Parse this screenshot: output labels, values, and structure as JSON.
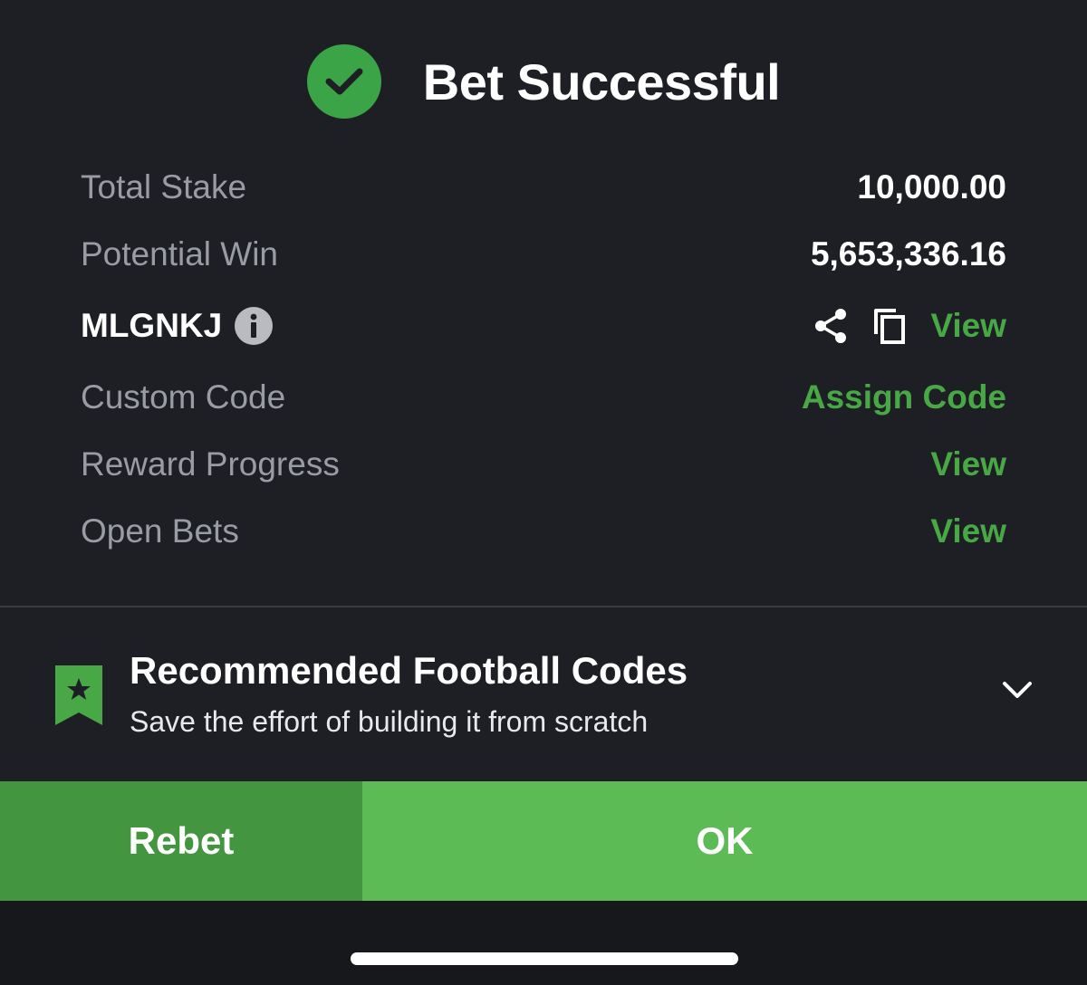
{
  "header": {
    "title": "Bet Successful",
    "icon": "check-circle-icon"
  },
  "summary": {
    "total_stake_label": "Total Stake",
    "total_stake_value": "10,000.00",
    "potential_win_label": "Potential Win",
    "potential_win_value": "5,653,336.16",
    "booking_code": "MLGNKJ",
    "booking_view_label": "View",
    "custom_code_label": "Custom Code",
    "custom_code_action": "Assign Code",
    "reward_progress_label": "Reward Progress",
    "reward_progress_action": "View",
    "open_bets_label": "Open Bets",
    "open_bets_action": "View"
  },
  "recommended": {
    "title": "Recommended Football Codes",
    "subtitle": "Save the effort of building it from scratch"
  },
  "buttons": {
    "rebet": "Rebet",
    "ok": "OK"
  },
  "colors": {
    "background": "#1e1f24",
    "accent_green": "#47a845",
    "success_green": "#3aa447",
    "rebet_green": "#43963f",
    "ok_green": "#5cbb55",
    "muted_text": "#9a9ca3"
  }
}
